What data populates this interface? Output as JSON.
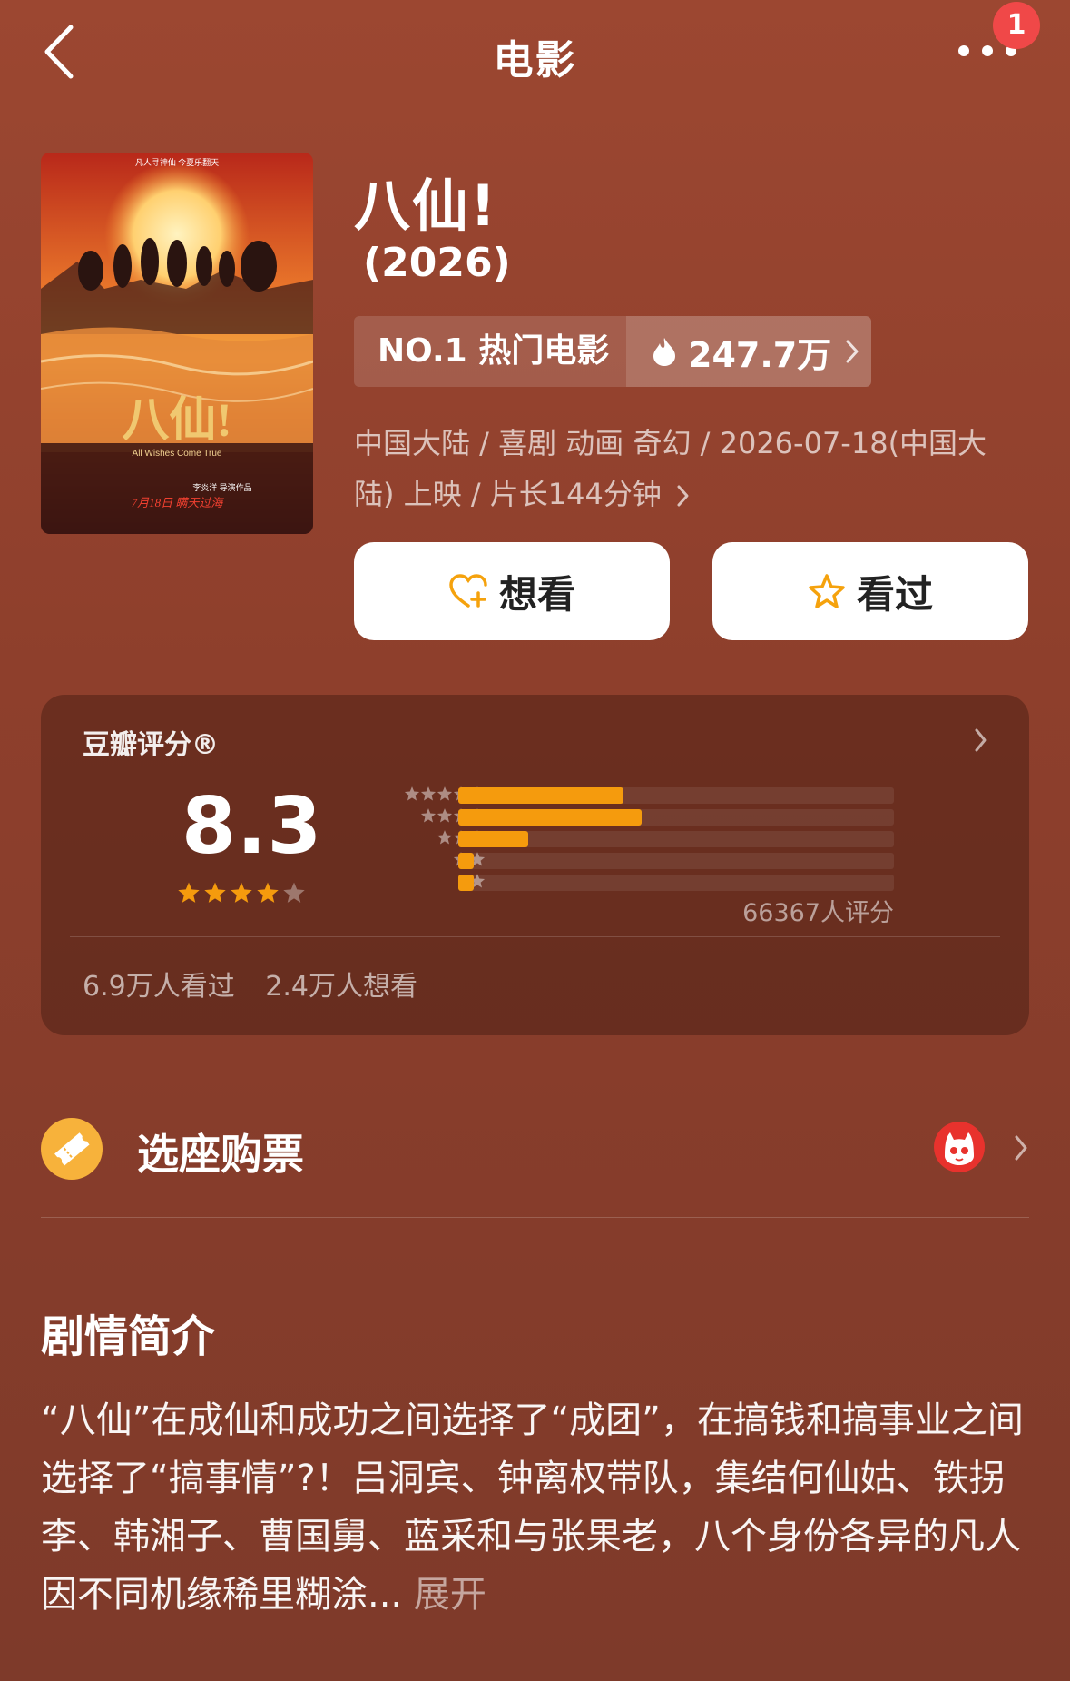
{
  "nav": {
    "title": "电影",
    "badge_count": "1"
  },
  "movie": {
    "title": "八仙!",
    "year": "(2026)",
    "rank_label": "NO.1 热门电影",
    "heat": "247.7万",
    "meta": "中国大陆 / 喜剧 动画 奇幻 / 2026-07-18(中国大陆) 上映 / 片长144分钟",
    "poster": {
      "top_text": "凡人寻神仙  今夏乐翻天",
      "logo": "八仙!",
      "subtitle": "All Wishes Come True",
      "director": "李炎洋 导演作品",
      "release": "7月18日 瞒天过海"
    }
  },
  "actions": {
    "want_label": "想看",
    "seen_label": "看过"
  },
  "rating": {
    "label": "豆瓣评分®",
    "score": "8.3",
    "score_stars": 4,
    "distribution": [
      {
        "stars": 5,
        "fraction": 0.38
      },
      {
        "stars": 4,
        "fraction": 0.42
      },
      {
        "stars": 3,
        "fraction": 0.16
      },
      {
        "stars": 2,
        "fraction": 0.035
      },
      {
        "stars": 1,
        "fraction": 0.035
      }
    ],
    "count": "66367人评分",
    "seen": "6.9万人看过",
    "want": "2.4万人想看"
  },
  "ticket": {
    "label": "选座购票"
  },
  "synopsis": {
    "title": "剧情简介",
    "text": "“八仙”在成仙和成功之间选择了“成团”，在搞钱和搞事业之间选择了“搞事情”?！吕洞宾、钟离权带队，集结何仙姑、铁拐李、韩湘子、曹国舅、蓝采和与张果老，八个身份各异的凡人因不同机缘稀里糊涂...",
    "more": "展开"
  },
  "colors": {
    "accent": "#f59b0d",
    "badge": "#f04848",
    "background": "#8e3f2c"
  }
}
